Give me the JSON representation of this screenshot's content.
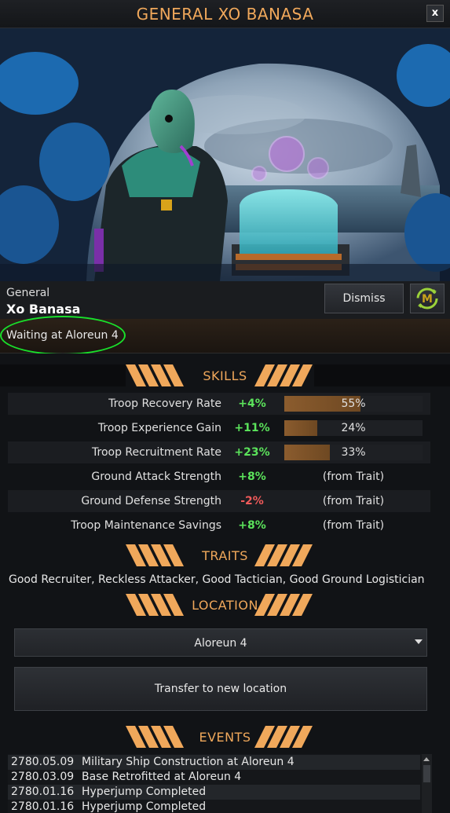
{
  "window": {
    "title": "GENERAL XO BANASA",
    "close_label": "x"
  },
  "header": {
    "role": "General",
    "name": "Xo Banasa",
    "dismiss_label": "Dismiss",
    "auto_icon": "automate-m-icon",
    "status": "Waiting at Aloreun 4"
  },
  "skills": {
    "heading": "SKILLS",
    "rows": [
      {
        "label": "Troop Recovery Rate",
        "bonus": "+4%",
        "value": "55%",
        "level": 0.55,
        "positive": true
      },
      {
        "label": "Troop Experience Gain",
        "bonus": "+11%",
        "value": "24%",
        "level": 0.24,
        "positive": true
      },
      {
        "label": "Troop Recruitment Rate",
        "bonus": "+23%",
        "value": "33%",
        "level": 0.33,
        "positive": true
      },
      {
        "label": "Ground Attack Strength",
        "bonus": "+8%",
        "value": "(from Trait)",
        "positive": true
      },
      {
        "label": "Ground Defense Strength",
        "bonus": "-2%",
        "value": "(from Trait)",
        "positive": false
      },
      {
        "label": "Troop Maintenance Savings",
        "bonus": "+8%",
        "value": "(from Trait)",
        "positive": true
      }
    ]
  },
  "traits": {
    "heading": "TRAITS",
    "text": "Good Recruiter, Reckless Attacker, Good Tactician, Good Ground Logistician"
  },
  "location": {
    "heading": "LOCATION",
    "selected": "Aloreun 4",
    "transfer_label": "Transfer to new location"
  },
  "events": {
    "heading": "EVENTS",
    "rows": [
      {
        "date": "2780.05.09",
        "text": "Military Ship Construction at Aloreun 4"
      },
      {
        "date": "2780.03.09",
        "text": "Base Retrofitted at Aloreun 4"
      },
      {
        "date": "2780.01.16",
        "text": "Hyperjump Completed"
      },
      {
        "date": "2780.01.16",
        "text": "Hyperjump Completed"
      }
    ]
  },
  "colors": {
    "accent": "#f0a85b",
    "positive": "#5be35b",
    "negative": "#f05a5a",
    "highlight": "#19e02b"
  }
}
